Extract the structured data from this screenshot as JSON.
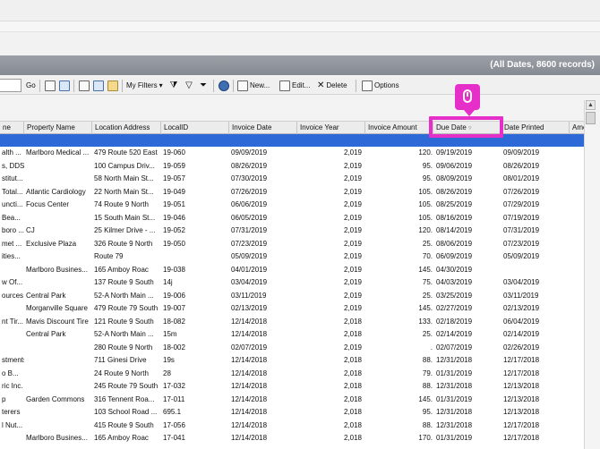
{
  "title_bar": {
    "record_info": "(All Dates, 8600 records)"
  },
  "toolbar": {
    "go_label": "Go",
    "my_filters_label": "My Filters",
    "new_label": "New...",
    "edit_label": "Edit...",
    "delete_label": "Delete",
    "options_label": "Options"
  },
  "columns": [
    {
      "label": "ne"
    },
    {
      "label": "Property Name"
    },
    {
      "label": "Location Address"
    },
    {
      "label": "LocalID"
    },
    {
      "label": "Invoice Date"
    },
    {
      "label": "Invoice Year"
    },
    {
      "label": "Invoice Amount"
    },
    {
      "label": "Due Date"
    },
    {
      "label": "Date Printed"
    },
    {
      "label": "Amo"
    }
  ],
  "rows": [
    {
      "c0": "alth ...",
      "c1": "Marlboro Medical ...",
      "c2": "479 Route 520 East",
      "c3": "19-060",
      "c4": "09/09/2019",
      "c5": "2,019",
      "c6": "120.",
      "c7": "09/19/2019",
      "c8": "09/09/2019"
    },
    {
      "c0": "s, DDS",
      "c1": "",
      "c2": "100 Campus Driv...",
      "c3": "19-059",
      "c4": "08/26/2019",
      "c5": "2,019",
      "c6": "95.",
      "c7": "09/06/2019",
      "c8": "08/26/2019"
    },
    {
      "c0": "stitut...",
      "c1": "",
      "c2": "58 North Main St...",
      "c3": "19-057",
      "c4": "07/30/2019",
      "c5": "2,019",
      "c6": "95.",
      "c7": "08/09/2019",
      "c8": "08/01/2019"
    },
    {
      "c0": "Total...",
      "c1": "Atlantic Cardiology",
      "c2": "22 North Main St...",
      "c3": "19-049",
      "c4": "07/26/2019",
      "c5": "2,019",
      "c6": "105.",
      "c7": "08/26/2019",
      "c8": "07/26/2019"
    },
    {
      "c0": "uncti...",
      "c1": "Focus Center",
      "c2": "74 Route 9 North",
      "c3": "19-051",
      "c4": "06/06/2019",
      "c5": "2,019",
      "c6": "105.",
      "c7": "08/25/2019",
      "c8": "07/29/2019"
    },
    {
      "c0": "Bea...",
      "c1": "",
      "c2": "15 South Main St...",
      "c3": "19-046",
      "c4": "06/05/2019",
      "c5": "2,019",
      "c6": "105.",
      "c7": "08/16/2019",
      "c8": "07/19/2019"
    },
    {
      "c0": "boro ...",
      "c1": "CJ",
      "c2": "25 Kilmer Drive - ...",
      "c3": "19-052",
      "c4": "07/31/2019",
      "c5": "2,019",
      "c6": "120.",
      "c7": "08/14/2019",
      "c8": "07/31/2019"
    },
    {
      "c0": "met ...",
      "c1": "Exclusive Plaza",
      "c2": "326 Route 9 North",
      "c3": "19-050",
      "c4": "07/23/2019",
      "c5": "2,019",
      "c6": "25.",
      "c7": "08/06/2019",
      "c8": "07/23/2019"
    },
    {
      "c0": "ities...",
      "c1": "",
      "c2": "Route 79",
      "c3": "",
      "c4": "05/09/2019",
      "c5": "2,019",
      "c6": "70.",
      "c7": "06/09/2019",
      "c8": "05/09/2019"
    },
    {
      "c0": "",
      "c1": "Marlboro Busines...",
      "c2": "165 Amboy Roac",
      "c3": "19-038",
      "c4": "04/01/2019",
      "c5": "2,019",
      "c6": "145.",
      "c7": "04/30/2019",
      "c8": ""
    },
    {
      "c0": "w Of...",
      "c1": "",
      "c2": "137 Route 9 South",
      "c3": "14j",
      "c4": "03/04/2019",
      "c5": "2,019",
      "c6": "75.",
      "c7": "04/03/2019",
      "c8": "03/04/2019"
    },
    {
      "c0": "ources",
      "c1": "Central Park",
      "c2": "52-A North Main ...",
      "c3": "19-006",
      "c4": "03/11/2019",
      "c5": "2,019",
      "c6": "25.",
      "c7": "03/25/2019",
      "c8": "03/11/2019"
    },
    {
      "c0": "",
      "c1": "Morganville Square",
      "c2": "479 Route 79 South",
      "c3": "19-007",
      "c4": "02/13/2019",
      "c5": "2,019",
      "c6": "145.",
      "c7": "02/27/2019",
      "c8": "02/13/2019"
    },
    {
      "c0": "nt Tir...",
      "c1": "Mavis Discount Tire",
      "c2": "121 Route 9 South",
      "c3": "18-082",
      "c4": "12/14/2018",
      "c5": "2,018",
      "c6": "133.",
      "c7": "02/18/2019",
      "c8": "06/04/2019"
    },
    {
      "c0": "",
      "c1": "Central Park",
      "c2": "52-A North Main ...",
      "c3": "15m",
      "c4": "12/14/2018",
      "c5": "2,018",
      "c6": "25.",
      "c7": "02/14/2019",
      "c8": "02/14/2019"
    },
    {
      "c0": "",
      "c1": "",
      "c2": "280 Route 9 North",
      "c3": "18-002",
      "c4": "02/07/2019",
      "c5": "2,019",
      "c6": ".",
      "c7": "02/07/2019",
      "c8": "02/26/2019"
    },
    {
      "c0": "stments",
      "c1": "",
      "c2": "711 Ginesi Drive",
      "c3": "19s",
      "c4": "12/14/2018",
      "c5": "2,018",
      "c6": "88.",
      "c7": "12/31/2018",
      "c8": "12/17/2018"
    },
    {
      "c0": "o B...",
      "c1": "",
      "c2": "24 Route 9 North",
      "c3": "28",
      "c4": "12/14/2018",
      "c5": "2,018",
      "c6": "79.",
      "c7": "01/31/2019",
      "c8": "12/17/2018"
    },
    {
      "c0": "ric Inc.",
      "c1": "",
      "c2": "245 Route 79 South",
      "c3": "17-032",
      "c4": "12/14/2018",
      "c5": "2,018",
      "c6": "88.",
      "c7": "12/31/2018",
      "c8": "12/13/2018"
    },
    {
      "c0": "p",
      "c1": "Garden Commons",
      "c2": "316 Tennent Roa...",
      "c3": "17-011",
      "c4": "12/14/2018",
      "c5": "2,018",
      "c6": "145.",
      "c7": "01/31/2019",
      "c8": "12/13/2018"
    },
    {
      "c0": "terers",
      "c1": "",
      "c2": "103 School Road ...",
      "c3": "695.1",
      "c4": "12/14/2018",
      "c5": "2,018",
      "c6": "95.",
      "c7": "12/31/2018",
      "c8": "12/13/2018"
    },
    {
      "c0": "l Nut...",
      "c1": "",
      "c2": "415 Route 9 South",
      "c3": "17-056",
      "c4": "12/14/2018",
      "c5": "2,018",
      "c6": "88.",
      "c7": "12/31/2018",
      "c8": "12/17/2018"
    },
    {
      "c0": "",
      "c1": "Marlboro Busines...",
      "c2": "165 Amboy Roac",
      "c3": "17-041",
      "c4": "12/14/2018",
      "c5": "2,018",
      "c6": "170.",
      "c7": "01/31/2019",
      "c8": "12/17/2018"
    }
  ],
  "highlight_color": "#e62ec8",
  "selection_color": "#2d6ad8"
}
